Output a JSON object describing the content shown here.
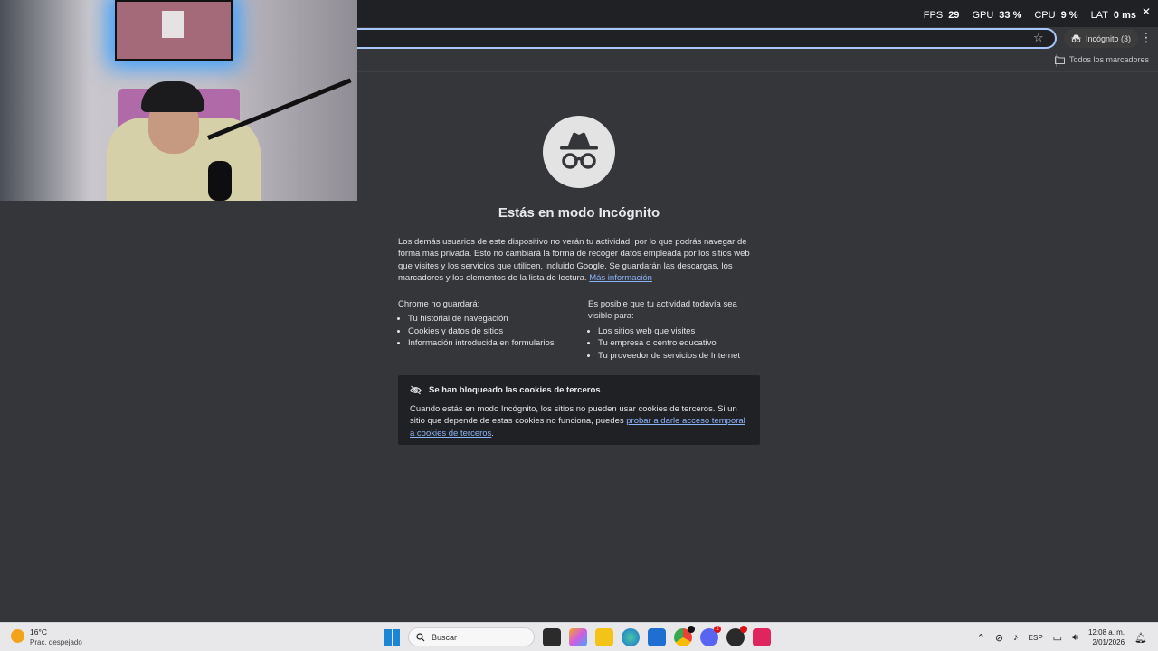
{
  "overlay": {
    "fps_label": "FPS",
    "fps_value": "29",
    "gpu_label": "GPU",
    "gpu_value": "33 %",
    "cpu_label": "CPU",
    "cpu_value": "9 %",
    "lat_label": "LAT",
    "lat_value": "0 ms"
  },
  "toolbar": {
    "incognito_chip": "Incógnito (3)"
  },
  "bookmarks": {
    "all_bookmarks": "Todos los marcadores"
  },
  "page": {
    "headline": "Estás en modo Incógnito",
    "intro": "Los demás usuarios de este dispositivo no verán tu actividad, por lo que podrás navegar de forma más privada. Esto no cambiará la forma de recoger datos empleada por los sitios web que visites y los servicios que utilicen, incluido Google. Se guardarán las descargas, los marcadores y los elementos de la lista de lectura.",
    "more_info_link": "Más información",
    "wont_save_title": "Chrome no guardará:",
    "wont_save": [
      "Tu historial de navegación",
      "Cookies y datos de sitios",
      "Información introducida en formularios"
    ],
    "visible_title": "Es posible que tu actividad todavía sea visible para:",
    "visible": [
      "Los sitios web que visites",
      "Tu empresa o centro educativo",
      "Tu proveedor de servicios de Internet"
    ],
    "cookie_title": "Se han bloqueado las cookies de terceros",
    "cookie_body": "Cuando estás en modo Incógnito, los sitios no pueden usar cookies de terceros. Si un sitio que depende de estas cookies no funciona, puedes",
    "cookie_link": "probar a darle acceso temporal a cookies de terceros",
    "cookie_end": "."
  },
  "taskbar": {
    "weather_temp": "16°C",
    "weather_desc": "Prac. despejado",
    "search_placeholder": "Buscar",
    "language": "ESP",
    "time": "12:08 a. m.",
    "date": "2/01/2026",
    "chat_badge": "2"
  },
  "colors": {
    "page_bg": "#35363a",
    "link": "#8ab4f8",
    "omnibox_focus": "#a8c7fa"
  }
}
